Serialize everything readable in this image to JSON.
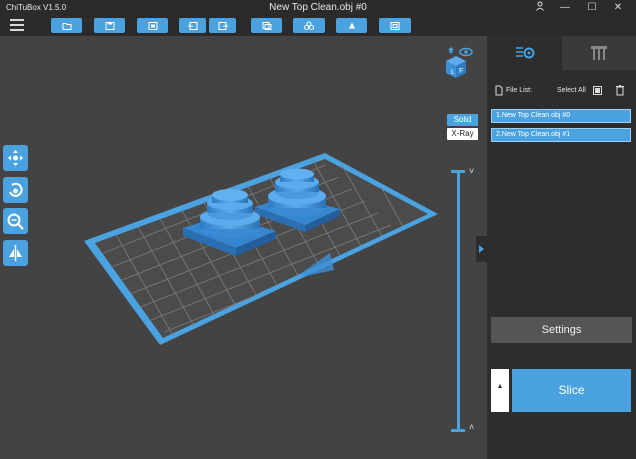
{
  "window": {
    "app_name": "ChiTuBox V1.5.0",
    "title": "New Top Clean.obj #0",
    "minimize": "—",
    "maximize": "☐",
    "close": "✕",
    "user_icon": "user-icon"
  },
  "toolbar": {
    "buttons": [
      {
        "name": "open-file-button",
        "icon": "folder-icon"
      },
      {
        "name": "save-button",
        "icon": "save-icon"
      },
      {
        "name": "import-button",
        "icon": "import-icon"
      },
      {
        "name": "undo-button",
        "icon": "undo-icon"
      },
      {
        "name": "redo-button",
        "icon": "redo-icon"
      },
      {
        "name": "copy-button",
        "icon": "copy-icon"
      },
      {
        "name": "auto-layout-button",
        "icon": "arrange-icon"
      },
      {
        "name": "support-button",
        "icon": "support-icon"
      },
      {
        "name": "hollow-button",
        "icon": "hollow-icon"
      }
    ]
  },
  "viewport": {
    "view_modes": {
      "solid": "Solid",
      "xray": "X-Ray"
    },
    "layer_slider": {
      "up": "˅",
      "down": "˄"
    },
    "side_tools": [
      "move-icon",
      "rotate-icon",
      "scale-icon",
      "mirror-icon"
    ],
    "view_cube": "view-cube-icon",
    "eye": "eye-icon",
    "home": "home-icon"
  },
  "panel": {
    "tabs": [
      "model-settings-tab",
      "supports-tab"
    ],
    "file_list_label": "File List:",
    "select_all_label": "Select All",
    "files": [
      "1.New Top Clean.obj #0",
      "2.New Top Clean.obj #1"
    ],
    "settings_label": "Settings",
    "slice_label": "Slice",
    "slice_side": "▲"
  },
  "colors": {
    "accent": "#4aa3e0",
    "background": "#434343",
    "panel": "#2d2d2d",
    "model": "#3d8fd6",
    "plate_border": "#4aa3e0"
  }
}
